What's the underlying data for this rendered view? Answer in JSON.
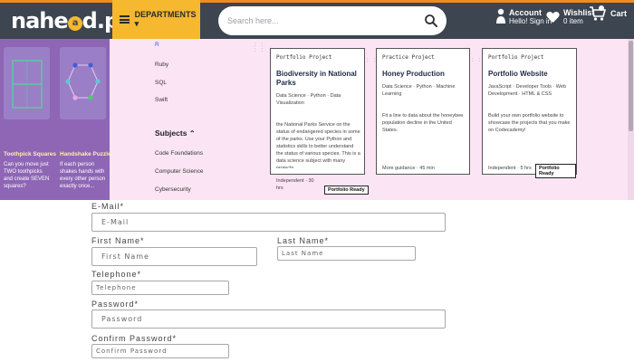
{
  "header": {
    "logo_text": "nahe",
    "logo_badge": "a",
    "logo_tail": "d.pk",
    "departments_label": "DEPARTMENTS ▾",
    "search_placeholder": "Search here...",
    "account_title": "Account",
    "account_sub": "Hello! Sign in",
    "wishlist_title": "Wishlist",
    "wishlist_sub": "0 item",
    "cart_label": "Cart",
    "accent": "#f5b82e",
    "bar_color": "#3c4550"
  },
  "mega": {
    "games": [
      {
        "title": "Toothpick Squares",
        "desc": "Can you move just TWO toothpicks and create SEVEN squares?"
      },
      {
        "title": "Handshake Puzzle",
        "desc": "If each person shakes hands with every other person exactly once..."
      }
    ],
    "menu_items": [
      "R",
      "Ruby",
      "SQL",
      "Swift"
    ],
    "subjects_heading": "Subjects",
    "subjects": [
      "Code Foundations",
      "Computer Science",
      "Cybersecurity"
    ],
    "cards": [
      {
        "label": "Portfolio Project",
        "title": "Biodiversity in National Parks",
        "tags": "Data Science · Python · Data Visualization",
        "desc": "the National Parks Service on the status of endangered species in some of the parks. Use your Python and statistics skills to better understand the status of various species. This is a data science subject with many projects",
        "meta": "Independent · 30 hrs",
        "badge": "Portfolio Ready"
      },
      {
        "label": "Practice Project",
        "title": "Honey Production",
        "tags": "Data Science · Python · Machine Learning",
        "desc": "Fit a line to data about the honeybee population decline in the United States.",
        "meta": "More guidance · 45 min",
        "badge": ""
      },
      {
        "label": "Portfolio Project",
        "title": "Portfolio Website",
        "tags": "JavaScript · Developer Tools · Web Development · HTML & CSS",
        "desc": "Build your own portfolio website to showcase the projects that you make on Codecademy!",
        "meta": "Independent · 5 hrs",
        "badge": "Portfolio Ready"
      }
    ]
  },
  "form": {
    "email_label": "E-Mail*",
    "email_placeholder": "E-Mail",
    "first_label": "First Name*",
    "first_placeholder": "First Name",
    "last_label": "Last Name*",
    "last_placeholder": "Last Name",
    "phone_label": "Telephone*",
    "phone_placeholder": "Telephone",
    "password_label": "Password*",
    "password_placeholder": "Password",
    "confirm_label": "Confirm Password*",
    "confirm_placeholder": "Confirm Password"
  }
}
